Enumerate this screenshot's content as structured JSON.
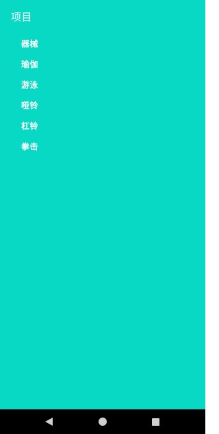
{
  "theme": {
    "background": "#08d9c4",
    "text": "#ffffff",
    "navbar": "#000000",
    "nav_icon": "#cfcfcf"
  },
  "drawer": {
    "title": "项目",
    "items": [
      {
        "label": "器械"
      },
      {
        "label": "瑜伽"
      },
      {
        "label": "游泳"
      },
      {
        "label": "哑铃"
      },
      {
        "label": "杠铃"
      },
      {
        "label": "拳击"
      }
    ]
  },
  "navbar": {
    "back_icon": "triangle-back-icon",
    "home_icon": "circle-home-icon",
    "recent_icon": "square-recents-icon"
  }
}
